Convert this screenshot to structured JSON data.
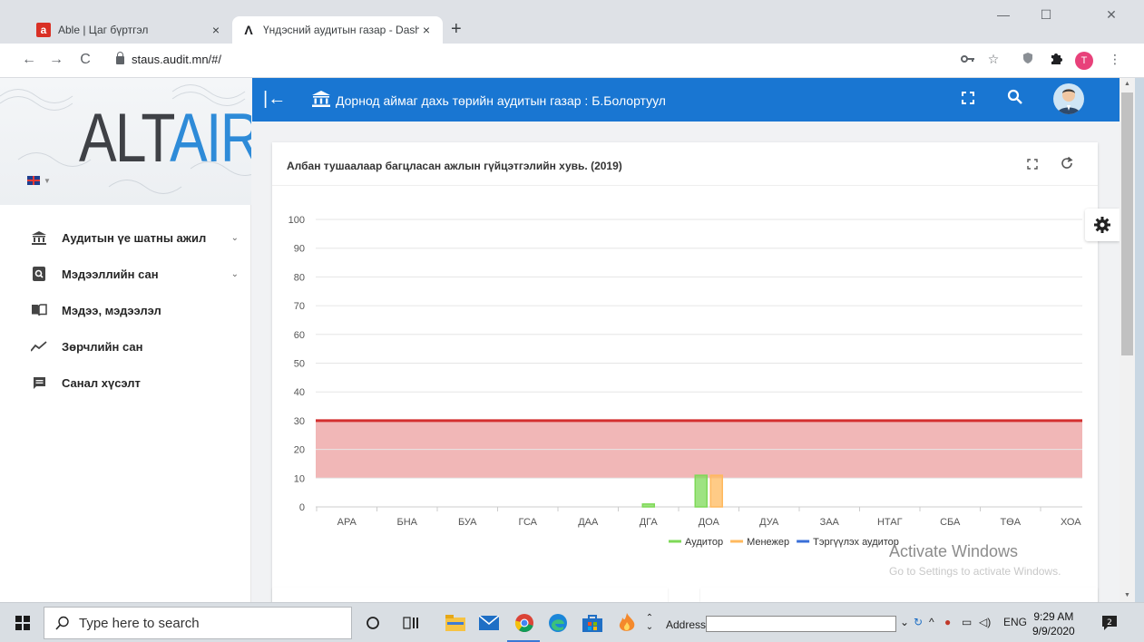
{
  "browser": {
    "tabs": [
      {
        "favicon": "a",
        "title": "Able | Цаг бүртгэл",
        "close": "×"
      },
      {
        "favicon": "Λ",
        "title": "Үндэсний аудитын газар - Dashl",
        "close": "×"
      }
    ],
    "new_tab": "+",
    "window_controls": {
      "minimize": "—",
      "maximize": "☐",
      "close": "✕"
    },
    "nav": {
      "back": "←",
      "forward": "→",
      "reload": "C"
    },
    "url": "staus.audit.mn/#/",
    "profile_initial": "T"
  },
  "sidebar": {
    "logo": {
      "dark": "ALT",
      "blue": "AIR"
    },
    "menu": [
      {
        "icon": "bank-icon",
        "label": "Аудитын үе шатны ажил",
        "has_caret": true
      },
      {
        "icon": "search-doc-icon",
        "label": "Мэдээллийн сан",
        "has_caret": true
      },
      {
        "icon": "book-icon",
        "label": "Мэдээ, мэдээлэл",
        "has_caret": false
      },
      {
        "icon": "trend-icon",
        "label": "Зөрчлийн сан",
        "has_caret": false
      },
      {
        "icon": "feedback-icon",
        "label": "Санал хүсэлт",
        "has_caret": false
      }
    ]
  },
  "header": {
    "title": "Дорнод аймаг дахь төрийн аудитын газар : Б.Болортуул",
    "back_icon": "|←"
  },
  "card": {
    "title": "Албан тушаалаар багцласан ажлын гүйцэтгэлийн хувь. (2019)"
  },
  "chart_data": {
    "type": "bar",
    "categories": [
      "АРА",
      "БНА",
      "БУА",
      "ГСА",
      "ДАА",
      "ДГА",
      "ДОА",
      "ДУА",
      "ЗАА",
      "НТАГ",
      "СБА",
      "ТӨА",
      "ХОА"
    ],
    "series": [
      {
        "name": "Аудитор",
        "color": "#7ed957",
        "values": [
          0,
          0,
          0,
          0,
          0,
          1,
          11,
          0,
          0,
          0,
          0,
          0,
          0
        ]
      },
      {
        "name": "Менежер",
        "color": "#ffb95e",
        "values": [
          0,
          0,
          0,
          0,
          0,
          0,
          11,
          0,
          0,
          0,
          0,
          0,
          0
        ]
      },
      {
        "name": "Тэргүүлэх аудитор",
        "color": "#3a6fd8",
        "values": [
          0,
          0,
          0,
          0,
          0,
          0,
          0,
          0,
          0,
          0,
          0,
          0,
          0
        ]
      }
    ],
    "ylim": [
      0,
      100
    ],
    "yticks": [
      0,
      10,
      20,
      30,
      40,
      50,
      60,
      70,
      80,
      90,
      100
    ],
    "threshold_band": {
      "from": 10,
      "to": 30,
      "color": "#eeaaaa"
    },
    "threshold_line": {
      "value": 30,
      "color": "#d32f2f"
    },
    "grid": true,
    "legend_position": "bottom"
  },
  "watermark": {
    "title": "Activate Windows",
    "subtitle": "Go to Settings to activate Windows."
  },
  "taskbar": {
    "search_placeholder": "Type here to search",
    "address_label": "Address",
    "language": "ENG",
    "time": "9:29 AM",
    "date": "9/9/2020",
    "notification_count": "2"
  }
}
